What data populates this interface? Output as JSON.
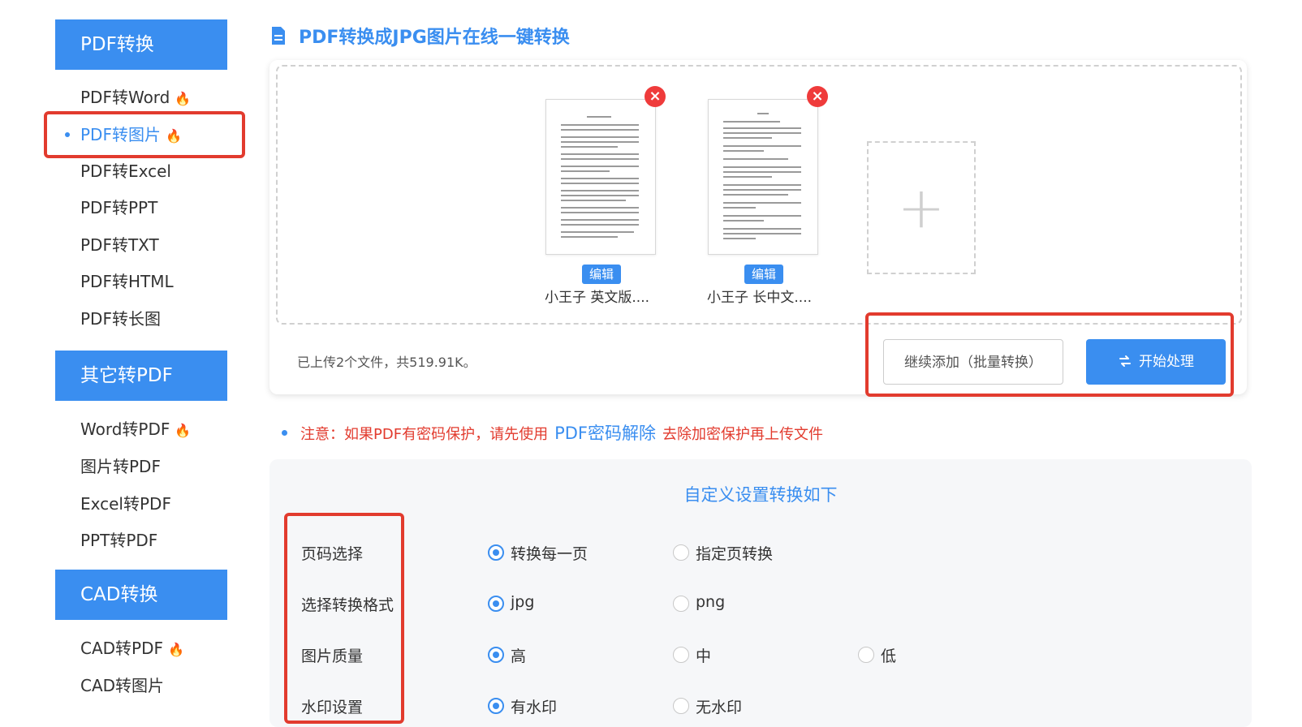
{
  "sidebar": {
    "sections": [
      {
        "header": "PDF转换",
        "items": [
          {
            "label": "PDF转Word",
            "hot": true
          },
          {
            "label": "PDF转图片",
            "hot": true
          },
          {
            "label": "PDF转Excel"
          },
          {
            "label": "PDF转PPT"
          },
          {
            "label": "PDF转TXT"
          },
          {
            "label": "PDF转HTML"
          },
          {
            "label": "PDF转长图"
          }
        ]
      },
      {
        "header": "其它转PDF",
        "items": [
          {
            "label": "Word转PDF",
            "hot": true
          },
          {
            "label": "图片转PDF"
          },
          {
            "label": "Excel转PDF"
          },
          {
            "label": "PPT转PDF"
          }
        ]
      },
      {
        "header": "CAD转换",
        "items": [
          {
            "label": "CAD转PDF",
            "hot": true
          },
          {
            "label": "CAD转图片"
          }
        ]
      }
    ],
    "active_item": "PDF转图片"
  },
  "page_title": "PDF转换成JPG图片在线一键转换",
  "upload": {
    "files": [
      {
        "name": "小王子 英文版....",
        "edit_label": "编辑"
      },
      {
        "name": "小王子 长中文....",
        "edit_label": "编辑"
      }
    ],
    "add_glyph": "+",
    "status": "已上传2个文件，共519.91K。",
    "continue_button": "继续添加（批量转换）",
    "start_button": "开始处理"
  },
  "notice": {
    "prefix": "注意：如果PDF有密码保护，请先使用",
    "link": "PDF密码解除",
    "suffix": "去除加密保护再上传文件"
  },
  "settings": {
    "title": "自定义设置转换如下",
    "rows": [
      {
        "label": "页码选择",
        "options": [
          "转换每一页",
          "指定页转换"
        ],
        "selected": 0
      },
      {
        "label": "选择转换格式",
        "options": [
          "jpg",
          "png"
        ],
        "selected": 0
      },
      {
        "label": "图片质量",
        "options": [
          "高",
          "中",
          "低"
        ],
        "selected": 0
      },
      {
        "label": "水印设置",
        "options": [
          "有水印",
          "无水印"
        ],
        "selected": 0
      }
    ]
  },
  "colors": {
    "accent": "#3a8ef0",
    "highlight_box": "#e23b2e",
    "hot_icon": "#ff6a1a",
    "notice_text": "#e23b2e"
  },
  "icons": {
    "hot": "fire-icon",
    "title": "document-icon",
    "remove": "close-icon",
    "start": "swap-icon",
    "add": "plus-icon"
  }
}
